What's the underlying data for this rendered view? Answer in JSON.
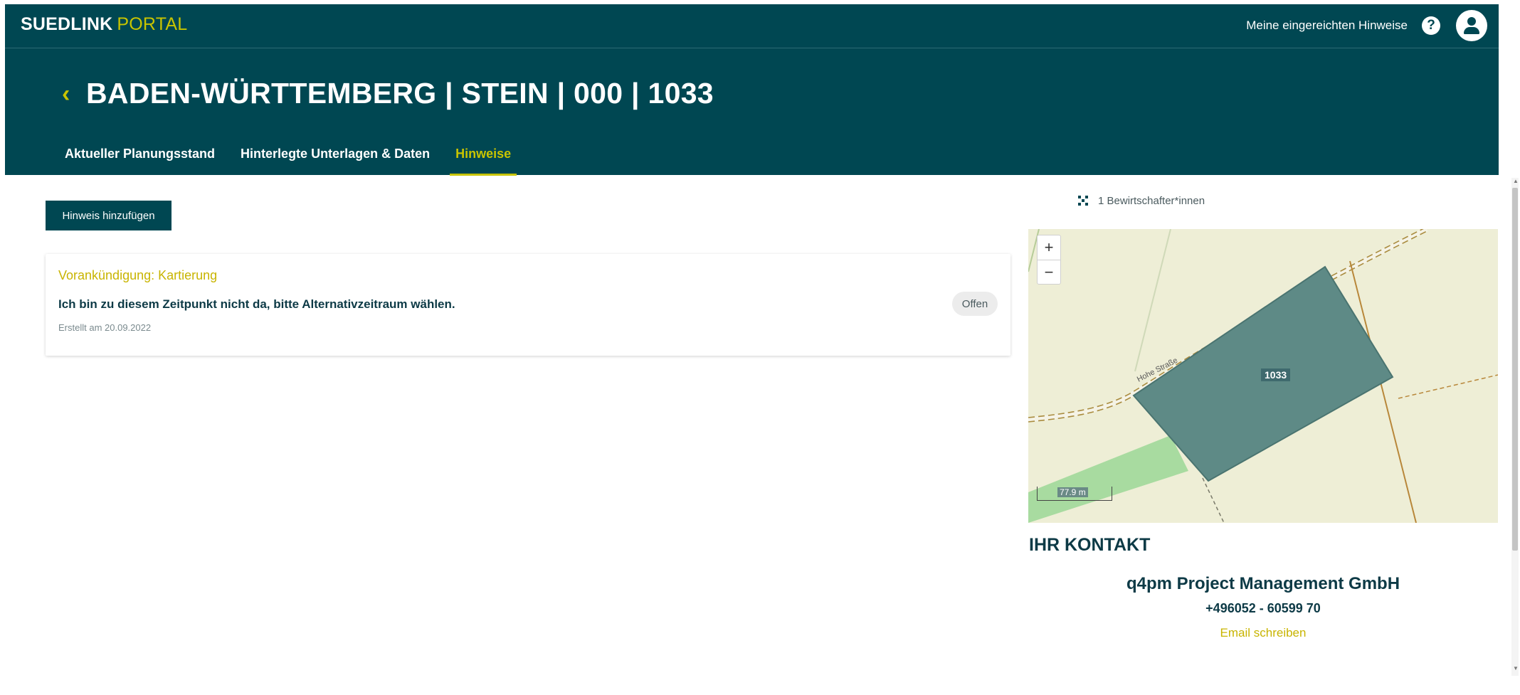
{
  "topbar": {
    "brand_primary": "SUEDLINK",
    "brand_secondary": "PORTAL",
    "my_hints_link": "Meine eingereichten Hinweise",
    "help_icon": "question-icon",
    "user_icon": "user-icon"
  },
  "header": {
    "back_icon": "‹",
    "title": "BADEN-WÜRTTEMBERG | STEIN | 000 | 1033",
    "tabs": [
      {
        "label": "Aktueller Planungsstand",
        "active": false
      },
      {
        "label": "Hinterlegte Unterlagen & Daten",
        "active": false
      },
      {
        "label": "Hinweise",
        "active": true
      }
    ]
  },
  "main": {
    "add_button": "Hinweis hinzufügen",
    "hint": {
      "category": "Vorankündigung: Kartierung",
      "text": "Ich bin zu diesem Zeitpunkt nicht da, bitte Alternativzeitraum wählen.",
      "created": "Erstellt am 20.09.2022",
      "status": "Offen"
    }
  },
  "sidebar": {
    "managers": "1 Bewirtschafter*innen",
    "map": {
      "zoom_in": "+",
      "zoom_out": "−",
      "road_label": "Hohe Straße",
      "parcel_label": "1033",
      "scale_label": "77.9 m"
    },
    "contact": {
      "title": "IHR KONTAKT",
      "company": "q4pm Project Management GmbH",
      "phone": "+496052 - 60599 70",
      "email_link": "Email schreiben"
    }
  },
  "colors": {
    "primary": "#004752",
    "accent": "#c8c400",
    "parcel": "#5e8a86",
    "map_bg": "#eeeed6"
  }
}
